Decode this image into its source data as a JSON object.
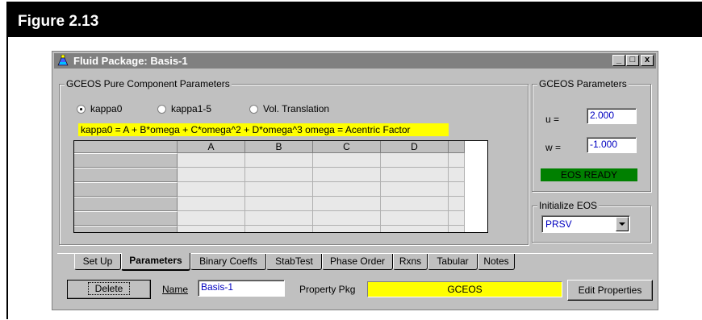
{
  "figure": {
    "title": "Figure 2.13"
  },
  "window": {
    "title": "Fluid Package: Basis-1",
    "controls": {
      "minimize": "_",
      "maximize": "□",
      "close": "x"
    }
  },
  "pure_params": {
    "group_label": "GCEOS Pure Component Parameters",
    "radios": [
      {
        "label": "kappa0",
        "selected": true
      },
      {
        "label": "kappa1-5",
        "selected": false
      },
      {
        "label": "Vol. Translation",
        "selected": false
      }
    ],
    "formula": "kappa0 = A + B*omega + C*omega^2 + D*omega^3    omega = Acentric Factor",
    "grid": {
      "columns": [
        "A",
        "B",
        "C",
        "D"
      ],
      "rows": [
        [
          "",
          "",
          "",
          ""
        ],
        [
          "",
          "",
          "",
          ""
        ],
        [
          "",
          "",
          "",
          ""
        ],
        [
          "",
          "",
          "",
          ""
        ],
        [
          "",
          "",
          "",
          ""
        ],
        [
          "",
          "",
          "",
          ""
        ]
      ]
    }
  },
  "gceos_params": {
    "group_label": "GCEOS Parameters",
    "u_label": "u =",
    "u_value": "2.000",
    "w_label": "w =",
    "w_value": "-1.000",
    "status": "EOS READY",
    "status_color": "#008000"
  },
  "initialize": {
    "group_label": "Initialize EOS",
    "selected": "PRSV"
  },
  "tabs": [
    {
      "label": "Set Up",
      "active": false
    },
    {
      "label": "Parameters",
      "active": true
    },
    {
      "label": "Binary Coeffs",
      "active": false
    },
    {
      "label": "StabTest",
      "active": false
    },
    {
      "label": "Phase Order",
      "active": false
    },
    {
      "label": "Rxns",
      "active": false
    },
    {
      "label": "Tabular",
      "active": false
    },
    {
      "label": "Notes",
      "active": false
    }
  ],
  "footer": {
    "delete_label": "Delete",
    "name_label": "Name",
    "name_value": "Basis-1",
    "property_pkg_label": "Property Pkg",
    "property_pkg_value": "GCEOS",
    "property_pkg_color": "#ffff00",
    "edit_properties_label": "Edit Properties"
  }
}
